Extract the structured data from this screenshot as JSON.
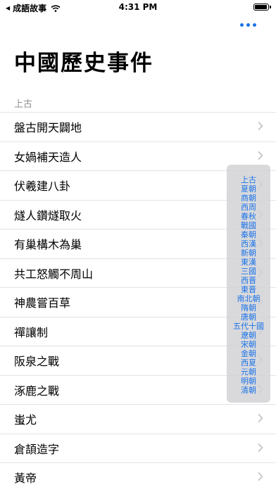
{
  "status_bar": {
    "back_app": "成語故事",
    "time": "4:31 PM",
    "battery_level": 0.95
  },
  "navigation": {
    "more_icon": "ellipsis-icon",
    "accent_color": "#1a73e8"
  },
  "page": {
    "title": "中國歷史事件"
  },
  "section": {
    "header": "上古",
    "items": [
      {
        "label": "盤古開天闢地"
      },
      {
        "label": "女媧補天造人"
      },
      {
        "label": "伏羲建八卦"
      },
      {
        "label": "燧人鑽燧取火"
      },
      {
        "label": "有巢構木為巢"
      },
      {
        "label": "共工怒觸不周山"
      },
      {
        "label": "神農嘗百草"
      },
      {
        "label": "禪讓制"
      },
      {
        "label": "阪泉之戰"
      },
      {
        "label": "涿鹿之戰"
      },
      {
        "label": "蚩尤"
      },
      {
        "label": "倉頡造字"
      },
      {
        "label": "黃帝"
      }
    ]
  },
  "section_index": [
    "上古",
    "夏朝",
    "商朝",
    "西周",
    "春秋",
    "戰國",
    "秦朝",
    "西漢",
    "新朝",
    "東漢",
    "三國",
    "西晋",
    "東晋",
    "南北朝",
    "隋朝",
    "唐朝",
    "五代十國",
    "遼朝",
    "宋朝",
    "金朝",
    "西夏",
    "元朝",
    "明朝",
    "清朝"
  ]
}
